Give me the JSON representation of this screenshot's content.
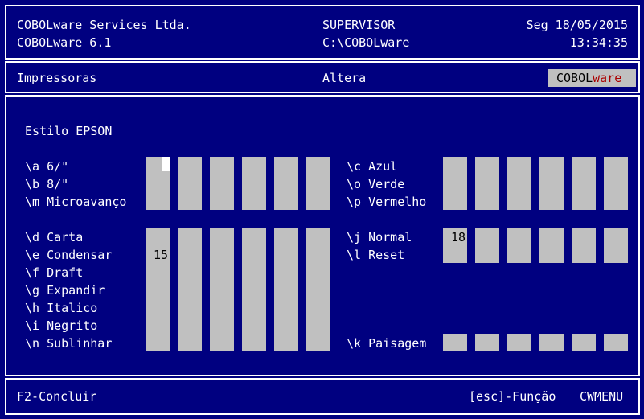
{
  "header": {
    "company": "COBOLware Services Ltda.",
    "product": "COBOLware 6.1",
    "user": "SUPERVISOR",
    "path": "C:\\COBOLware",
    "date": "Seg 18/05/2015",
    "time": "13:34:35"
  },
  "titlebar": {
    "module": "Impressoras",
    "mode": "Altera",
    "logo_a": "COBOL",
    "logo_b": "ware"
  },
  "main": {
    "heading": "Estilo EPSON",
    "left_options": [
      "\\a 6/\"",
      "\\b 8/\"",
      "\\m Microavanço",
      "\\d Carta",
      "\\e Condensar",
      "\\f Draft",
      "\\g Expandir",
      "\\h Italico",
      "\\i Negrito",
      "\\n Sublinhar"
    ],
    "right_options": [
      "\\c Azul",
      "\\o Verde",
      "\\p Vermelho",
      "\\j Normal",
      "\\l Reset",
      "\\k Paisagem"
    ],
    "values": {
      "condensar_first": "15",
      "normal_first": "18"
    },
    "cursor_char": "_"
  },
  "footer": {
    "left": "F2-Concluir",
    "esc": "[esc]-Função",
    "menu": "CWMENU"
  }
}
